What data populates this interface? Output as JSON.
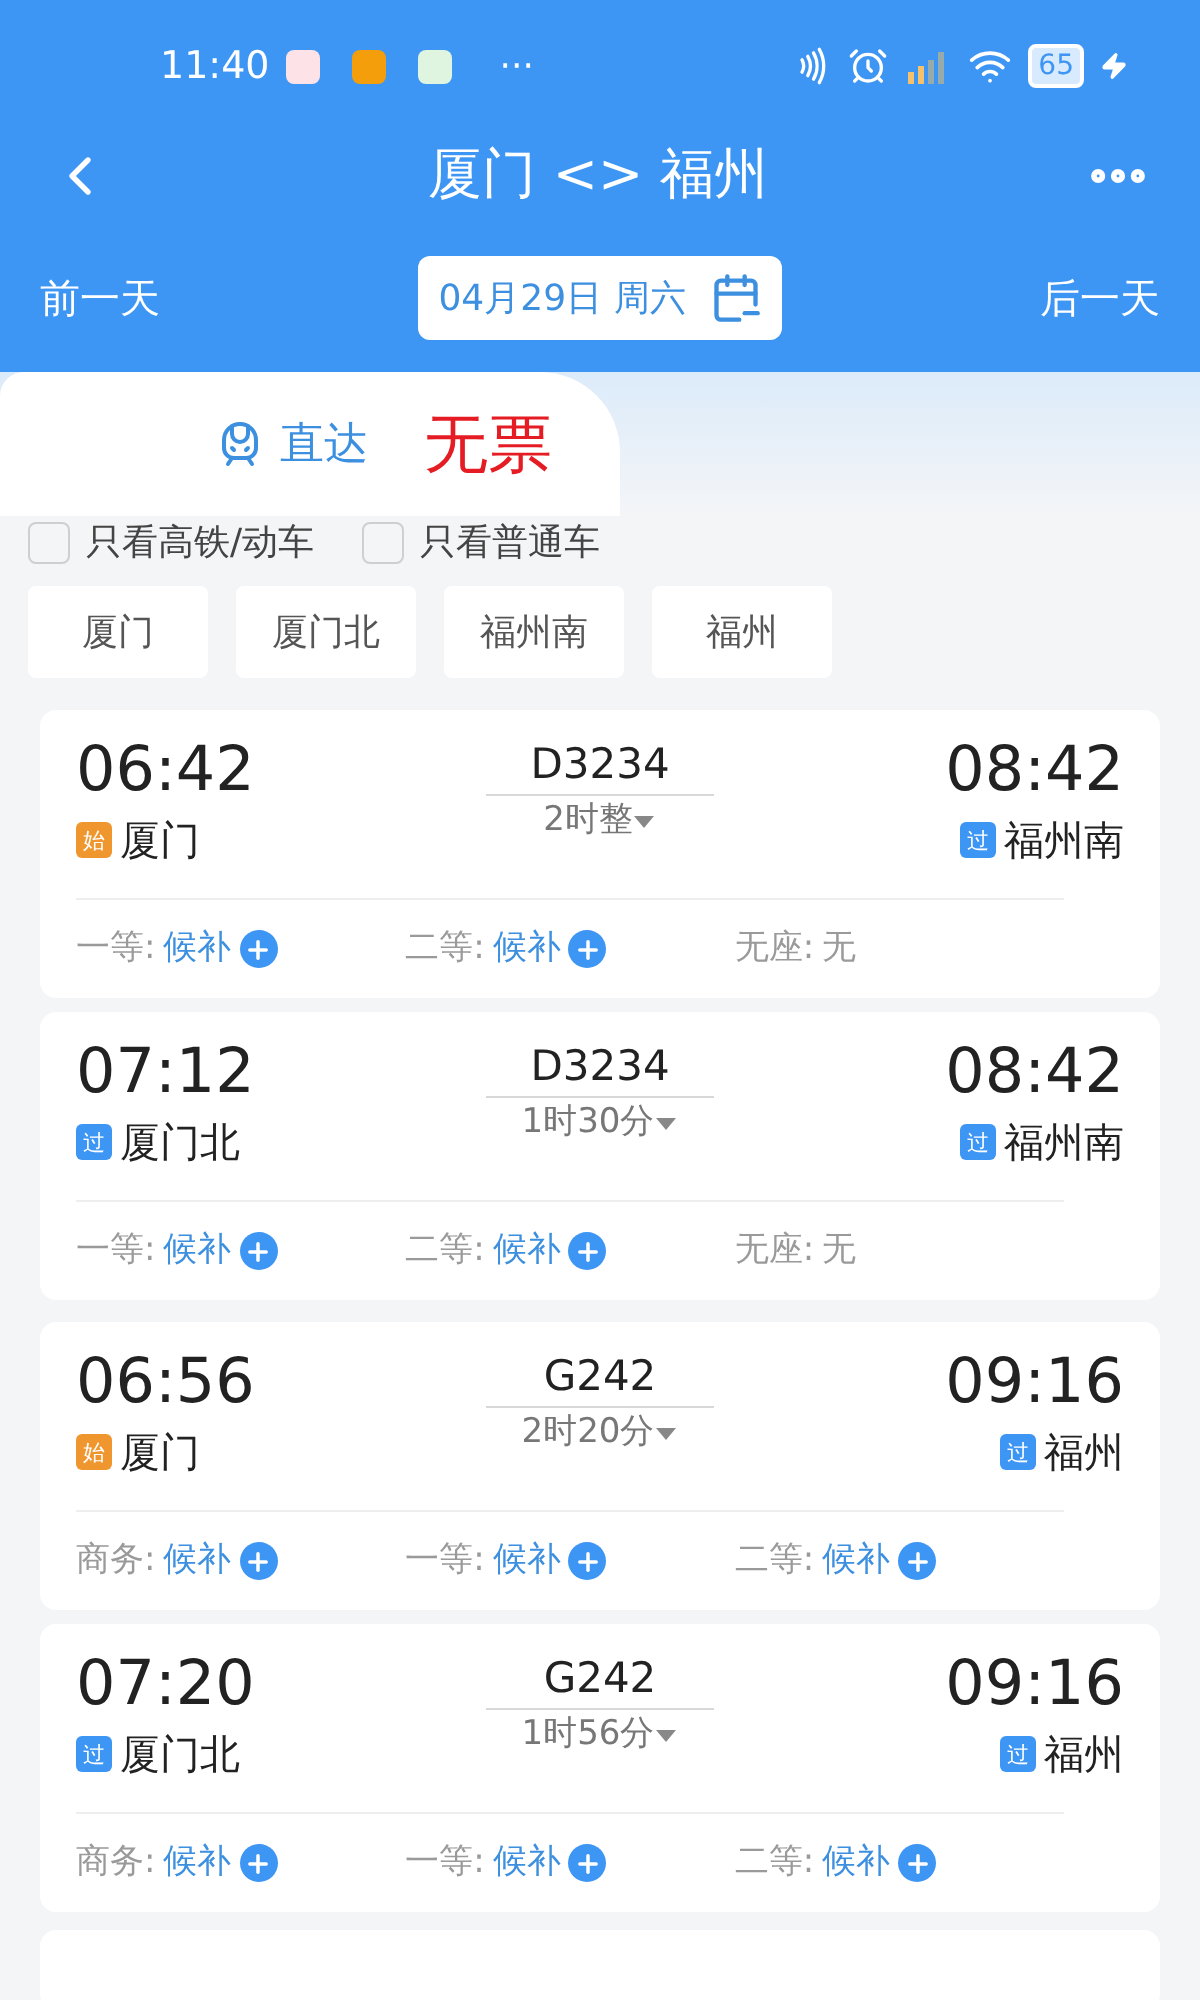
{
  "status_bar": {
    "time": "11:40",
    "more": "···",
    "battery": "65"
  },
  "nav": {
    "title": "厦门 <> 福州"
  },
  "date_bar": {
    "prev": "前一天",
    "date": "04月29日 周六",
    "next": "后一天"
  },
  "tabs": [
    {
      "label": "直达",
      "selected": true
    }
  ],
  "annotation": "无票",
  "filters": [
    {
      "label": "只看高铁/动车",
      "checked": false
    },
    {
      "label": "只看普通车",
      "checked": false
    }
  ],
  "stations": [
    {
      "label": "厦门",
      "selected": false
    },
    {
      "label": "厦门北",
      "selected": false
    },
    {
      "label": "福州南",
      "selected": false
    },
    {
      "label": "福州",
      "selected": false
    }
  ],
  "trains": [
    {
      "depart": "06:42",
      "from": "厦门",
      "from_origin": true,
      "from_badge": "始",
      "number": "D3234",
      "duration": "2时整",
      "arrive": "08:42",
      "to": "福州南",
      "to_origin": false,
      "to_badge": "过",
      "seats": [
        {
          "label": "一等:",
          "value": "候补",
          "kind": "waitlist"
        },
        {
          "label": "二等:",
          "value": "候补",
          "kind": "waitlist"
        },
        {
          "label": "无座:",
          "value": "无",
          "kind": "none"
        }
      ]
    },
    {
      "depart": "07:12",
      "from": "厦门北",
      "from_origin": false,
      "from_badge": "过",
      "number": "D3234",
      "duration": "1时30分",
      "arrive": "08:42",
      "to": "福州南",
      "to_origin": false,
      "to_badge": "过",
      "seats": [
        {
          "label": "一等:",
          "value": "候补",
          "kind": "waitlist"
        },
        {
          "label": "二等:",
          "value": "候补",
          "kind": "waitlist"
        },
        {
          "label": "无座:",
          "value": "无",
          "kind": "none"
        }
      ]
    },
    {
      "depart": "06:56",
      "from": "厦门",
      "from_origin": true,
      "from_badge": "始",
      "number": "G242",
      "duration": "2时20分",
      "arrive": "09:16",
      "to": "福州",
      "to_origin": false,
      "to_badge": "过",
      "seats": [
        {
          "label": "商务:",
          "value": "候补",
          "kind": "waitlist"
        },
        {
          "label": "一等:",
          "value": "候补",
          "kind": "waitlist"
        },
        {
          "label": "二等:",
          "value": "候补",
          "kind": "waitlist"
        }
      ]
    },
    {
      "depart": "07:20",
      "from": "厦门北",
      "from_origin": false,
      "from_badge": "过",
      "number": "G242",
      "duration": "1时56分",
      "arrive": "09:16",
      "to": "福州",
      "to_origin": false,
      "to_badge": "过",
      "seats": [
        {
          "label": "商务:",
          "value": "候补",
          "kind": "waitlist"
        },
        {
          "label": "一等:",
          "value": "候补",
          "kind": "waitlist"
        },
        {
          "label": "二等:",
          "value": "候补",
          "kind": "waitlist"
        }
      ]
    }
  ]
}
